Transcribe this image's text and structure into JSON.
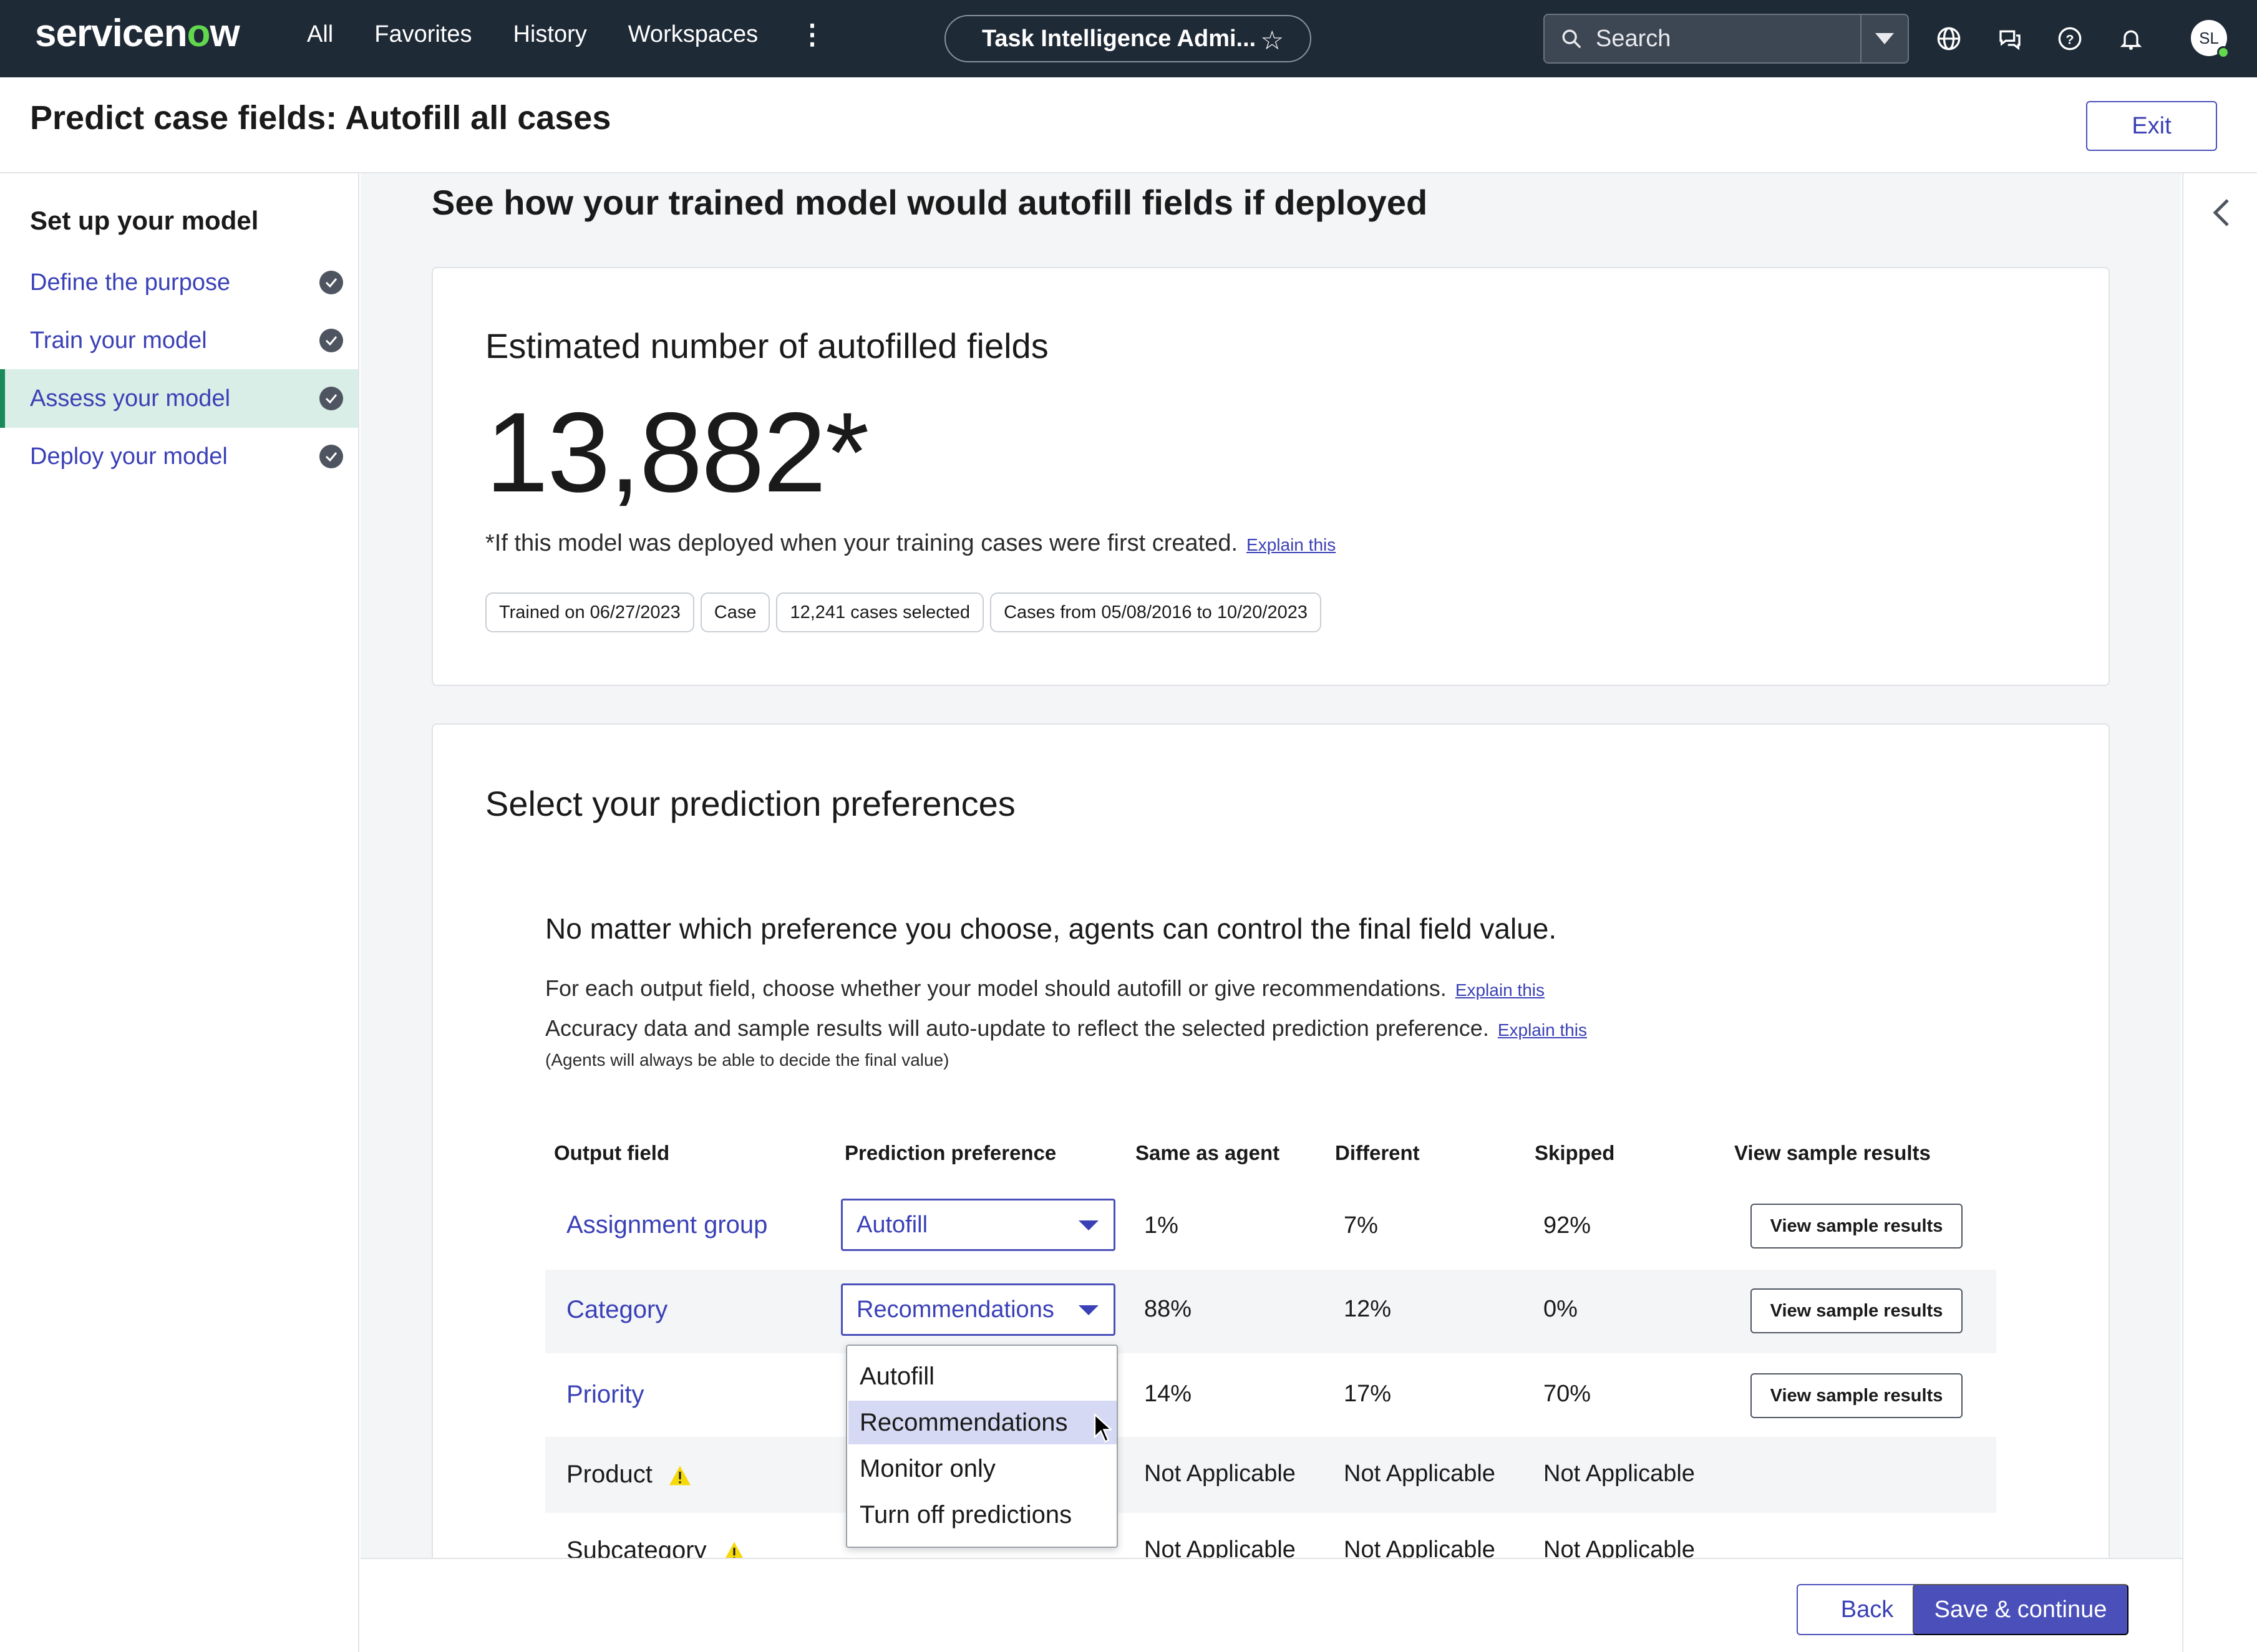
{
  "topnav": {
    "logo": "servicenow",
    "links": [
      "All",
      "Favorites",
      "History",
      "Workspaces"
    ],
    "more_icon": "more-vertical-icon",
    "context_title": "Task Intelligence Admi...",
    "search_placeholder": "Search",
    "icons": [
      "globe-icon",
      "chat-icon",
      "help-icon",
      "bell-icon"
    ],
    "avatar_initials": "SL"
  },
  "page": {
    "title": "Predict case fields: Autofill all cases",
    "exit_label": "Exit"
  },
  "sidebar": {
    "heading": "Set up your model",
    "items": [
      {
        "label": "Define the purpose",
        "complete": true
      },
      {
        "label": "Train your model",
        "complete": true
      },
      {
        "label": "Assess your model",
        "complete": true,
        "active": true
      },
      {
        "label": "Deploy your model",
        "complete": true
      }
    ]
  },
  "main": {
    "section_title": "See how your trained model would autofill fields if deployed",
    "estimate": {
      "title": "Estimated number of autofilled fields",
      "value": "13,882*",
      "footnote": "*If this model was deployed when your training cases were first created.",
      "explain_label": "Explain this",
      "chips": [
        "Trained on 06/27/2023",
        "Case",
        "12,241 cases selected",
        "Cases from 05/08/2016 to 10/20/2023"
      ]
    },
    "preferences": {
      "title": "Select your prediction preferences",
      "note": "No matter which preference you choose, agents can control the final field value.",
      "line1": "For each output field, choose whether your model should autofill or give recommendations.",
      "line2": "Accuracy data and sample results will auto-update to reflect the selected prediction preference.",
      "explain_label": "Explain this",
      "small": "(Agents will always be able to decide the final value)",
      "columns": [
        "Output field",
        "Prediction preference",
        "Same as agent",
        "Different",
        "Skipped",
        "View sample results"
      ],
      "rows": [
        {
          "field": "Assignment group",
          "preference": "Autofill",
          "same": "1%",
          "different": "7%",
          "skipped": "92%",
          "button": "View sample results"
        },
        {
          "field": "Category",
          "preference": "Recommendations",
          "same": "88%",
          "different": "12%",
          "skipped": "0%",
          "button": "View sample results"
        },
        {
          "field": "Priority",
          "preference": "",
          "same": "14%",
          "different": "17%",
          "skipped": "70%",
          "button": "View sample results"
        },
        {
          "field": "Product",
          "preference": "",
          "same": "Not Applicable",
          "different": "Not Applicable",
          "skipped": "Not Applicable",
          "warning": true
        },
        {
          "field": "Subcategory",
          "preference": "",
          "same": "Not Applicable",
          "different": "Not Applicable",
          "skipped": "Not Applicable",
          "warning": true
        }
      ],
      "dropdown_options": [
        "Autofill",
        "Recommendations",
        "Monitor only",
        "Turn off predictions"
      ],
      "dropdown_highlighted": "Recommendations"
    }
  },
  "actions": {
    "back_label": "Back",
    "save_label": "Save & continue"
  },
  "colors": {
    "nav_bg": "#1f2a37",
    "accent": "#4a4fba",
    "logo_green": "#62d84e",
    "active_bg": "#d9eee6",
    "active_border": "#1a8a5a",
    "warning": "#f5d90a"
  }
}
